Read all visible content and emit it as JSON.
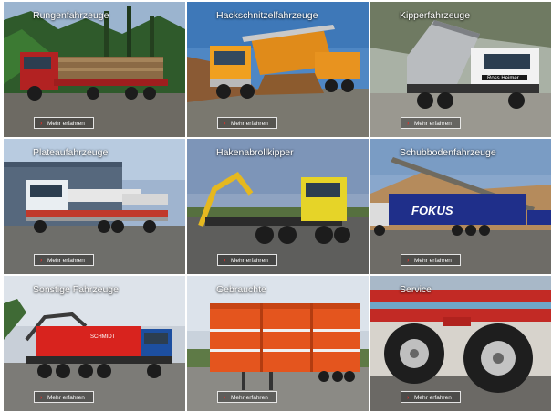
{
  "colors": {
    "accent": "#e0312b",
    "title": "#ffffff"
  },
  "icons": {
    "more_arrow": "chevron-right-icon"
  },
  "tiles": [
    {
      "title": "Rungenfahrzeuge",
      "button": "Mehr erfahren"
    },
    {
      "title": "Hackschnitzelfahrzeuge",
      "button": "Mehr erfahren"
    },
    {
      "title": "Kipperfahrzeuge",
      "button": "Mehr erfahren"
    },
    {
      "title": "Plateaufahrzeuge",
      "button": "Mehr erfahren"
    },
    {
      "title": "Hakenabrollkipper",
      "button": "Mehr erfahren"
    },
    {
      "title": "Schubbodenfahrzeuge",
      "button": "Mehr erfahren"
    },
    {
      "title": "Sonstige Fahrzeuge",
      "button": "Mehr erfahren"
    },
    {
      "title": "Gebrauchte",
      "button": "Mehr erfahren"
    },
    {
      "title": "Service",
      "button": "Mehr erfahren"
    }
  ],
  "truck_labels": {
    "kipper_cab": "Ross Heimer",
    "fokus_trailer": "FOKUS",
    "sonstige_body": "SCHMIDT"
  }
}
